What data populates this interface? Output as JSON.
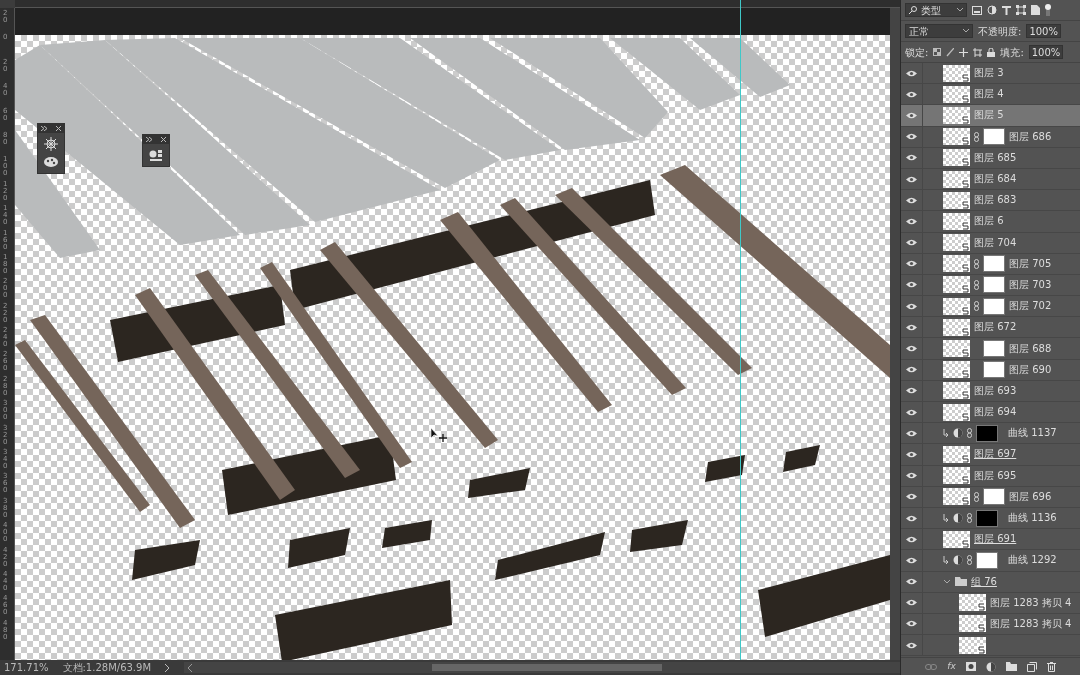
{
  "canvas": {
    "ruler_labels": [
      "20",
      "0",
      "20",
      "40",
      "60",
      "80",
      "100",
      "120",
      "140",
      "160",
      "180",
      "200",
      "220",
      "240",
      "260",
      "280",
      "300",
      "320",
      "340",
      "360",
      "380",
      "400",
      "420",
      "440",
      "460",
      "480"
    ]
  },
  "layers_panel": {
    "filter": "类型",
    "blend_mode": "正常",
    "opacity_label": "不透明度:",
    "opacity": "100%",
    "lock_label": "锁定:",
    "fill_label": "填充:",
    "fill": "100%",
    "fx_label": "fx",
    "layers": [
      {
        "kind": "layer",
        "name": "图层 3",
        "visible": true,
        "selected": false,
        "underlined": false
      },
      {
        "kind": "layer",
        "name": "图层 4",
        "visible": true,
        "selected": false,
        "underlined": false
      },
      {
        "kind": "layer",
        "name": "图层 5",
        "visible": true,
        "selected": true,
        "underlined": false
      },
      {
        "kind": "masked",
        "name": "图层 686",
        "visible": true,
        "selected": false,
        "underlined": false,
        "linked": true,
        "mask_dark": false
      },
      {
        "kind": "layer",
        "name": "图层 685",
        "visible": true,
        "selected": false,
        "underlined": false
      },
      {
        "kind": "layer",
        "name": "图层 684",
        "visible": true,
        "selected": false,
        "underlined": false
      },
      {
        "kind": "layer",
        "name": "图层 683",
        "visible": true,
        "selected": false,
        "underlined": false
      },
      {
        "kind": "layer",
        "name": "图层 6",
        "visible": true,
        "selected": false,
        "underlined": false
      },
      {
        "kind": "layer",
        "name": "图层 704",
        "visible": true,
        "selected": false,
        "underlined": false
      },
      {
        "kind": "masked",
        "name": "图层 705",
        "visible": true,
        "selected": false,
        "underlined": false,
        "linked": true,
        "mask_dark": false
      },
      {
        "kind": "masked",
        "name": "图层 703",
        "visible": true,
        "selected": false,
        "underlined": false,
        "linked": true,
        "mask_dark": false
      },
      {
        "kind": "masked",
        "name": "图层 702",
        "visible": true,
        "selected": false,
        "underlined": false,
        "linked": true,
        "mask_dark": false
      },
      {
        "kind": "layer",
        "name": "图层 672",
        "visible": true,
        "selected": false,
        "underlined": false
      },
      {
        "kind": "masked",
        "name": "图层 688",
        "visible": true,
        "selected": false,
        "underlined": false,
        "linked": false,
        "mask_dark": false
      },
      {
        "kind": "masked",
        "name": "图层 690",
        "visible": true,
        "selected": false,
        "underlined": false,
        "linked": false,
        "mask_dark": false
      },
      {
        "kind": "layer",
        "name": "图层 693",
        "visible": true,
        "selected": false,
        "underlined": false
      },
      {
        "kind": "layer",
        "name": "图层 694",
        "visible": true,
        "selected": false,
        "underlined": false
      },
      {
        "kind": "curves",
        "name": "曲线 1137",
        "visible": true,
        "selected": false,
        "underlined": false,
        "linked": true,
        "mask_dark": true
      },
      {
        "kind": "layer",
        "name": "图层 697",
        "visible": true,
        "selected": false,
        "underlined": true
      },
      {
        "kind": "layer",
        "name": "图层 695",
        "visible": true,
        "selected": false,
        "underlined": false
      },
      {
        "kind": "masked",
        "name": "图层 696",
        "visible": true,
        "selected": false,
        "underlined": false,
        "linked": true,
        "mask_dark": false
      },
      {
        "kind": "curves",
        "name": "曲线 1136",
        "visible": true,
        "selected": false,
        "underlined": false,
        "linked": true,
        "mask_dark": true
      },
      {
        "kind": "layer",
        "name": "图层 691",
        "visible": true,
        "selected": false,
        "underlined": true
      },
      {
        "kind": "curves",
        "name": "曲线 1292",
        "visible": true,
        "selected": false,
        "underlined": false,
        "linked": true,
        "mask_dark": false
      },
      {
        "kind": "group",
        "name": "组 76",
        "visible": true,
        "selected": false,
        "underlined": true,
        "expanded": true,
        "children": [
          {
            "kind": "layer",
            "name": "图层 1283 拷贝 4",
            "visible": true,
            "selected": false,
            "underlined": false
          },
          {
            "kind": "layer",
            "name": "图层 1283 拷贝 4",
            "visible": true,
            "selected": false,
            "underlined": false
          },
          {
            "kind": "layer",
            "visible": true,
            "selected": false
          }
        ]
      }
    ]
  },
  "status_bar": {
    "zoom": "171.71%",
    "doc_info": "文档:1.28M/63.9M"
  }
}
